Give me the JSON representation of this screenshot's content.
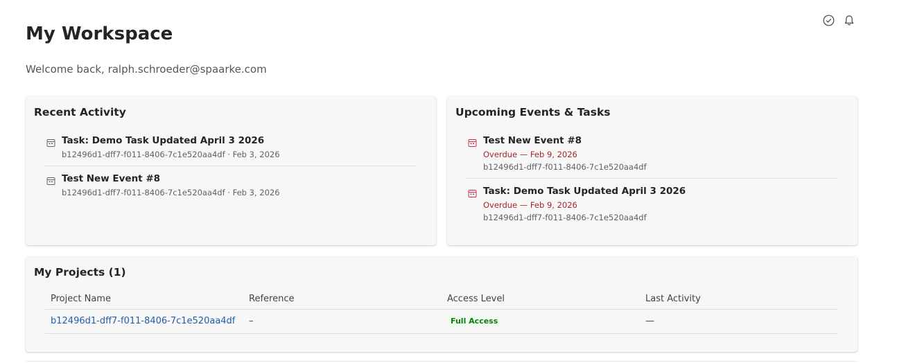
{
  "header": {
    "title": "My Workspace",
    "welcome": "Welcome back, ralph.schroeder@spaarke.com",
    "icons": [
      "check-circle-icon",
      "bell-icon"
    ]
  },
  "recent_activity": {
    "title": "Recent Activity",
    "items": [
      {
        "title": "Task: Demo Task Updated April 3 2026",
        "meta": "b12496d1-dff7-f011-8406-7c1e520aa4df · Feb 3, 2026",
        "icon": "calendar-icon"
      },
      {
        "title": "Test New Event #8",
        "meta": "b12496d1-dff7-f011-8406-7c1e520aa4df · Feb 3, 2026",
        "icon": "calendar-icon"
      }
    ]
  },
  "upcoming": {
    "title": "Upcoming Events & Tasks",
    "items": [
      {
        "title": "Test New Event #8",
        "due": "Overdue — Feb 9, 2026",
        "ref": "b12496d1-dff7-f011-8406-7c1e520aa4df",
        "icon": "calendar-icon"
      },
      {
        "title": "Task: Demo Task Updated April 3 2026",
        "due": "Overdue — Feb 9, 2026",
        "ref": "b12496d1-dff7-f011-8406-7c1e520aa4df",
        "icon": "calendar-icon"
      }
    ]
  },
  "projects": {
    "title": "My Projects (1)",
    "columns": [
      "Project Name",
      "Reference",
      "Access Level",
      "Last Activity"
    ],
    "rows": [
      {
        "name": "b12496d1-dff7-f011-8406-7c1e520aa4df",
        "reference": "–",
        "access": "Full Access",
        "last_activity": "—"
      }
    ]
  },
  "colors": {
    "overdue": "#a4262c",
    "link": "#1f5fa8",
    "badge_text": "#107c10",
    "badge_bg": "#f1faf1",
    "card_bg": "#f7f7f7"
  }
}
